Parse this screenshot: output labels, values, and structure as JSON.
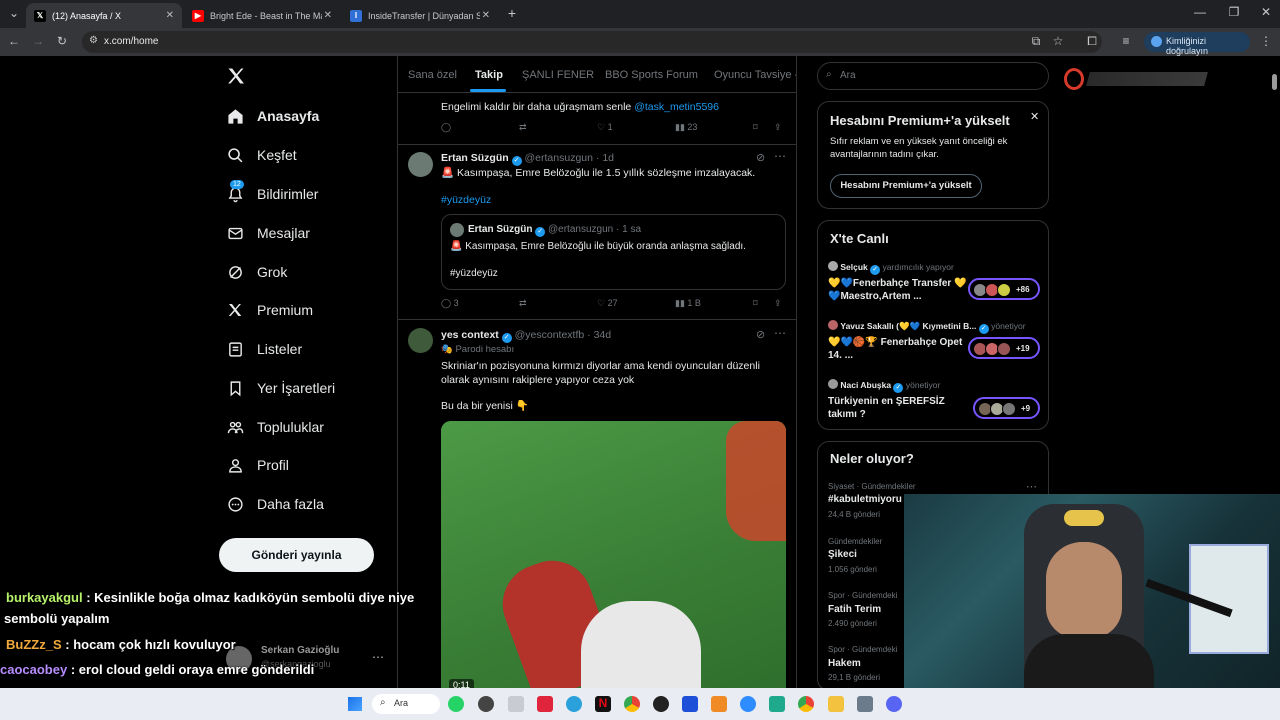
{
  "browser": {
    "tabs": [
      {
        "title": "(12) Anasayfa / X",
        "active": true
      },
      {
        "title": "Bright Ede - Beast in The Makin",
        "active": false
      },
      {
        "title": "InsideTransfer | Dünyadan Son",
        "active": false
      }
    ],
    "url": "x.com/home",
    "verify_label": "Kimliğinizi doğrulayın"
  },
  "sidebar": {
    "items": [
      {
        "label": "Anasayfa",
        "icon": "home-icon"
      },
      {
        "label": "Keşfet",
        "icon": "search-icon"
      },
      {
        "label": "Bildirimler",
        "icon": "bell-icon",
        "badge": "12"
      },
      {
        "label": "Mesajlar",
        "icon": "mail-icon"
      },
      {
        "label": "Grok",
        "icon": "grok-icon"
      },
      {
        "label": "Premium",
        "icon": "x-logo-icon"
      },
      {
        "label": "Listeler",
        "icon": "list-icon"
      },
      {
        "label": "Yer İşaretleri",
        "icon": "bookmark-icon"
      },
      {
        "label": "Topluluklar",
        "icon": "communities-icon"
      },
      {
        "label": "Profil",
        "icon": "person-icon"
      },
      {
        "label": "Daha fazla",
        "icon": "more-circle-icon"
      }
    ],
    "post_button": "Gönderi yayınla",
    "account": {
      "name": "Serkan Gazioğlu",
      "handle": "@serkangazioglu"
    }
  },
  "feed": {
    "tabs": [
      "Sana özel",
      "Takip",
      "ŞANLI FENER",
      "BBO Sports Forum",
      "Oyuncu Tavsiye -"
    ],
    "tweets": [
      {
        "text": "Engelimi kaldır bir daha uğraşmam senle",
        "mention": "@task_metin5596",
        "stats": {
          "replies": "",
          "reposts": "",
          "likes": "1",
          "views": "23"
        }
      },
      {
        "name": "Ertan Süzgün",
        "handle": "@ertansuzgun",
        "time": "1d",
        "text": "🚨 Kasımpaşa, Emre Belözoğlu ile 1.5 yıllık sözleşme imzalayacak.",
        "hashtag": "#yüzdeyüz",
        "quote": {
          "name": "Ertan Süzgün",
          "handle": "@ertansuzgun",
          "time": "1 sa",
          "text": "🚨 Kasımpaşa, Emre Belözoğlu ile büyük oranda anlaşma sağladı.",
          "hashtag": "#yüzdeyüz"
        },
        "stats": {
          "replies": "3",
          "reposts": "",
          "likes": "27",
          "views": "1 B"
        }
      },
      {
        "name": "yes context",
        "handle": "@yescontextfb",
        "time": "34d",
        "badge": "Parodi hesabı",
        "text": "Skriniar'ın pozisyonuna kırmızı diyorlar ama kendi oyuncuları düzenli olarak aynısını rakiplere yapıyor ceza yok",
        "text2": "Bu da bir yenisi 👇",
        "video_time": "0:11"
      }
    ]
  },
  "right": {
    "search_placeholder": "Ara",
    "premium": {
      "title": "Hesabını Premium+'a yükselt",
      "body": "Sıfır reklam ve en yüksek yanıt önceliği ek avantajlarının tadını çıkar.",
      "button": "Hesabını Premium+'a yükselt"
    },
    "live": {
      "title": "X'te Canlı",
      "items": [
        {
          "host": "Selçuk",
          "role": "yardımcılık yapıyor",
          "title": "💛💙Fenerbahçe Transfer 💛💙Maestro,Artem ...",
          "count": "+86"
        },
        {
          "host": "Yavuz Sakallı (💛💙 Kıymetini B...",
          "role": "yönetiyor",
          "title": "💛💙🏀🏆 Fenerbahçe Opet 14. ...",
          "count": "+19"
        },
        {
          "host": "Naci Abuşka",
          "role": "yönetiyor",
          "title": "Türkiyenin en ŞEREFSİZ takımı ?",
          "count": "+9"
        }
      ]
    },
    "trends": {
      "title": "Neler oluyor?",
      "items": [
        {
          "category": "Siyaset · Gündemdekiler",
          "name": "#kabuletmiyoru",
          "count": "24,4 B gönderi"
        },
        {
          "category": "Gündemdekiler",
          "name": "Şikeci",
          "count": "1.056 gönderi"
        },
        {
          "category": "Spor · Gündemdeki",
          "name": "Fatih Terim",
          "count": "2.490 gönderi"
        },
        {
          "category": "Spor · Gündemdeki",
          "name": "Hakem",
          "count": "29,1 B gönderi"
        }
      ]
    }
  },
  "chat": [
    {
      "user": "burkayakgul",
      "color": "#b6f26b",
      "message": ": Kesinlikle boğa olmaz kadıköyün sembolü diye niye",
      "cont": "sembolü yapalım"
    },
    {
      "user": "BuZZz_S",
      "color": "#f2a93b",
      "message": ": hocam çok hızlı kovuluyor"
    },
    {
      "user": "caocaobey",
      "color": "#b78cff",
      "message": ": erol cloud geldi oraya emre gönderildi"
    }
  ],
  "taskbar": {
    "search": "Ara"
  },
  "colors": {
    "accent": "#1d9bf0",
    "live_pill": "#7856ff",
    "background": "#000000"
  }
}
